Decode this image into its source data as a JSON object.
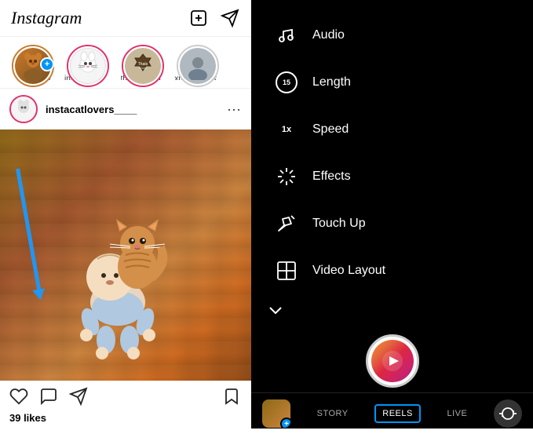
{
  "app": {
    "name": "Instagram"
  },
  "left": {
    "top_bar": {
      "logo": "Instagram",
      "new_post_icon": "➕",
      "send_icon": "✈"
    },
    "stories": [
      {
        "label": "Your Story",
        "type": "your",
        "has_ring": true
      },
      {
        "label": "instacatlovers_",
        "type": "cat",
        "has_ring": true
      },
      {
        "label": "thats_wood_",
        "type": "badge",
        "has_ring": true
      },
      {
        "label": "xronis_pegk_",
        "type": "person",
        "has_ring": false
      }
    ],
    "post": {
      "username": "instacatlovers____",
      "likes": "39 likes"
    },
    "actions": {
      "like": "♡",
      "comment": "💬",
      "share": "✈",
      "bookmark": "🔖"
    }
  },
  "right": {
    "menu": [
      {
        "id": "audio",
        "label": "Audio"
      },
      {
        "id": "length",
        "label": "Length"
      },
      {
        "id": "speed",
        "label": "Speed"
      },
      {
        "id": "effects",
        "label": "Effects"
      },
      {
        "id": "touch_up",
        "label": "Touch Up"
      },
      {
        "id": "video_layout",
        "label": "Video Layout"
      }
    ],
    "bottom_tabs": [
      {
        "id": "story",
        "label": "STORY",
        "active": false
      },
      {
        "id": "reels",
        "label": "REELS",
        "active": true
      },
      {
        "id": "live",
        "label": "LIVE",
        "active": false
      }
    ]
  }
}
